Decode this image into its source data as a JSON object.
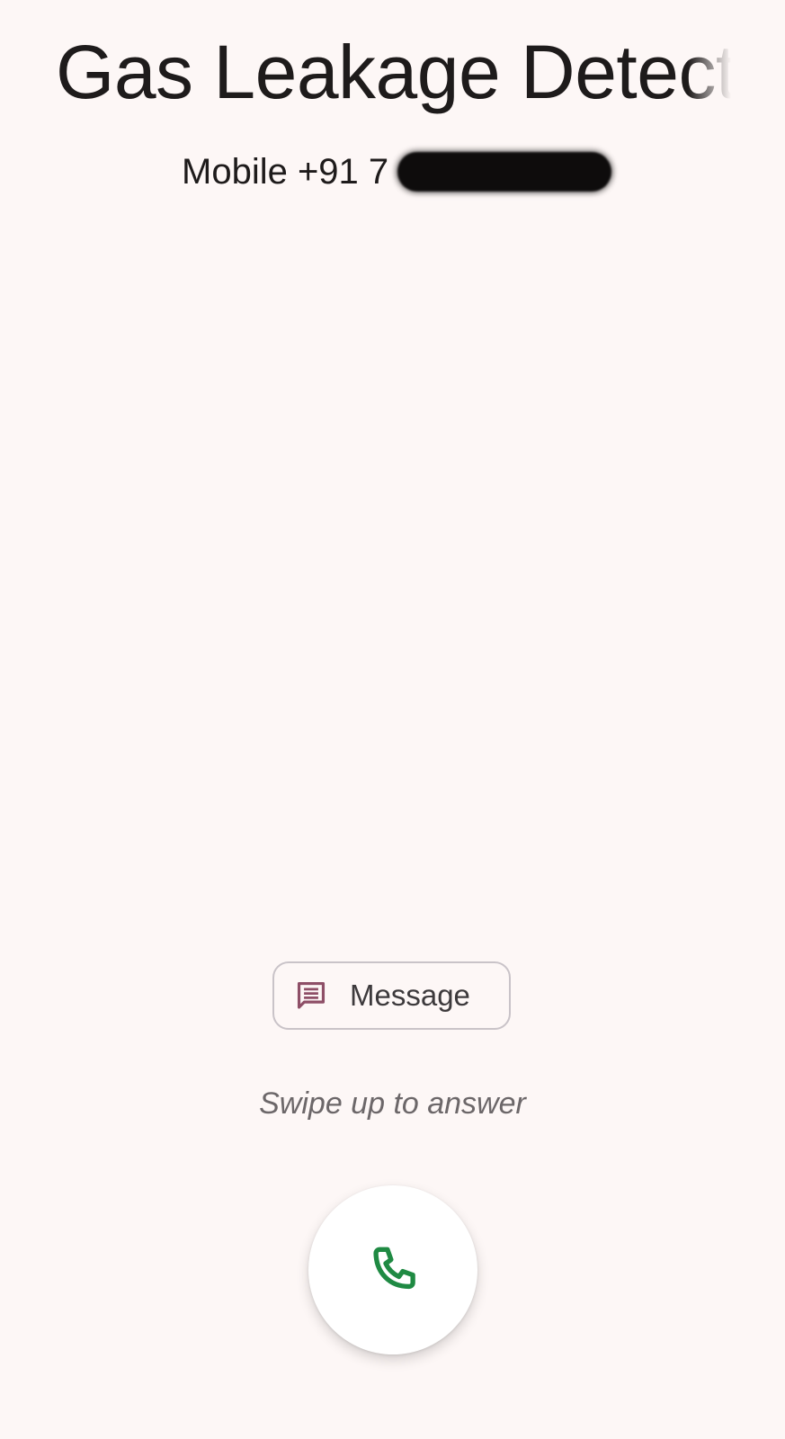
{
  "caller": {
    "name": "Gas Leakage Detecti",
    "number_label": "Mobile +91 7"
  },
  "actions": {
    "message_label": "Message",
    "message_icon": "message-icon",
    "swipe_hint": "Swipe up to answer",
    "answer_icon": "phone-icon"
  },
  "colors": {
    "background": "#fdf7f6",
    "message_icon": "#8e4f67",
    "answer_icon": "#1f8a43"
  }
}
